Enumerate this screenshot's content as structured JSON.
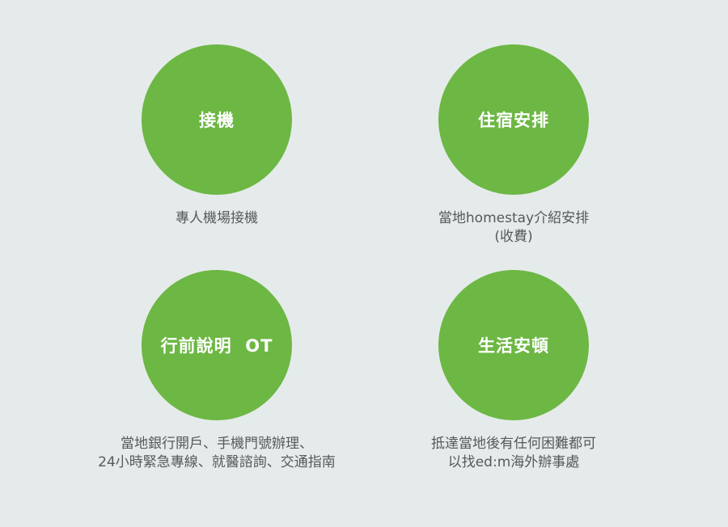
{
  "services": [
    {
      "title": "接機",
      "description": [
        "專人機場接機"
      ]
    },
    {
      "title": "住宿安排",
      "description": [
        "當地homestay介紹安排",
        "(收費)"
      ]
    },
    {
      "title": "行前說明  OT",
      "description": [
        "當地銀行開戶、手機門號辦理、",
        "24小時緊急專線、就醫諮詢、交通指南"
      ]
    },
    {
      "title": "生活安頓",
      "description": [
        "抵達當地後有任何困難都可",
        "以找ed:m海外辦事處"
      ]
    }
  ],
  "colors": {
    "background": "#e5ebea",
    "circle": "#6db744",
    "circle_text": "#ffffff",
    "description_text": "#555a5a"
  }
}
